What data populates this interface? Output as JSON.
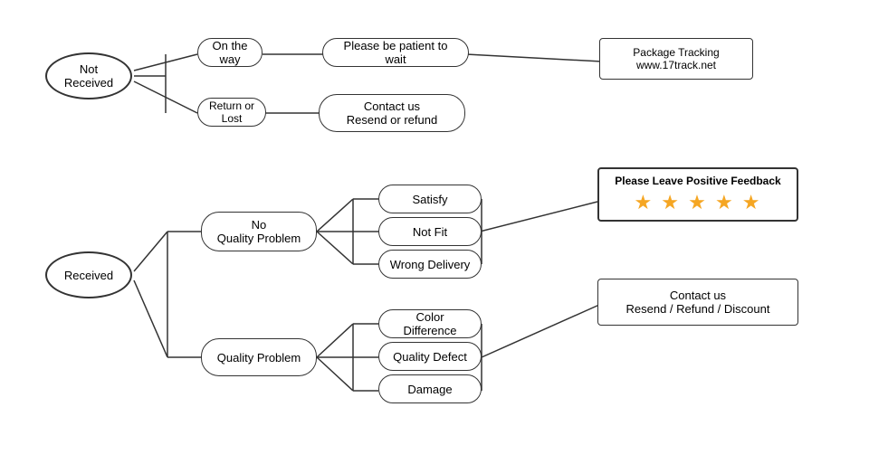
{
  "nodes": {
    "not_received": {
      "label": "Not\nReceived"
    },
    "on_the_way": {
      "label": "On the way"
    },
    "patient": {
      "label": "Please be patient to wait"
    },
    "package_tracking": {
      "label": "Package Tracking\nwww.17track.net"
    },
    "return_or_lost": {
      "label": "Return or Lost"
    },
    "contact_resend_refund": {
      "label": "Contact us\nResend or refund"
    },
    "received": {
      "label": "Received"
    },
    "no_quality_problem": {
      "label": "No\nQuality Problem"
    },
    "satisfy": {
      "label": "Satisfy"
    },
    "not_fit": {
      "label": "Not Fit"
    },
    "wrong_delivery": {
      "label": "Wrong Delivery"
    },
    "quality_problem": {
      "label": "Quality Problem"
    },
    "color_difference": {
      "label": "Color Difference"
    },
    "quality_defect": {
      "label": "Quality Defect"
    },
    "damage": {
      "label": "Damage"
    },
    "feedback": {
      "label": "Please Leave Positive Feedback",
      "stars": "★ ★ ★ ★ ★"
    },
    "contact_resend_refund_discount": {
      "label": "Contact us\nResend / Refund / Discount"
    }
  }
}
